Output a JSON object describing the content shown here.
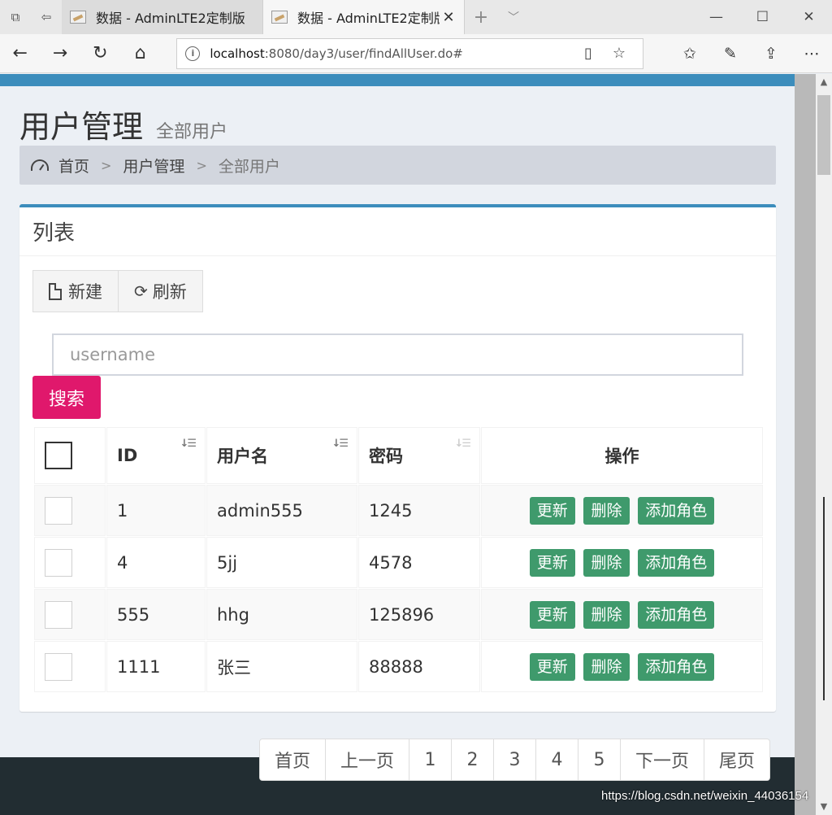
{
  "browser": {
    "tabs": [
      {
        "title": "数据 - AdminLTE2定制版",
        "active": false
      },
      {
        "title": "数据 - AdminLTE2定制版",
        "active": true
      }
    ],
    "url_host": "localhost",
    "url_path": ":8080/day3/user/findAllUser.do#"
  },
  "header": {
    "title": "用户管理",
    "subtitle": "全部用户"
  },
  "breadcrumb": {
    "home": "首页",
    "section": "用户管理",
    "current": "全部用户"
  },
  "box": {
    "title": "列表",
    "new_label": "新建",
    "refresh_label": "刷新",
    "search_placeholder": "username",
    "search_label": "搜索"
  },
  "table": {
    "columns": {
      "id": "ID",
      "username": "用户名",
      "password": "密码",
      "actions": "操作"
    },
    "rows": [
      {
        "id": "1",
        "username": "admin555",
        "password": "1245"
      },
      {
        "id": "4",
        "username": "5jj",
        "password": "4578"
      },
      {
        "id": "555",
        "username": "hhg",
        "password": "125896"
      },
      {
        "id": "1111",
        "username": "张三",
        "password": "88888"
      }
    ],
    "action_labels": {
      "update": "更新",
      "delete": "删除",
      "add_role": "添加角色"
    }
  },
  "pagination": {
    "first": "首页",
    "prev": "上一页",
    "pages": [
      "1",
      "2",
      "3",
      "4",
      "5"
    ],
    "next": "下一页",
    "last": "尾页"
  },
  "watermark": "https://blog.csdn.net/weixin_44036154",
  "colors": {
    "primary": "#3c8dbc",
    "search_button": "#e0186c",
    "action_button": "#3f9a6c",
    "footer": "#222d32"
  }
}
